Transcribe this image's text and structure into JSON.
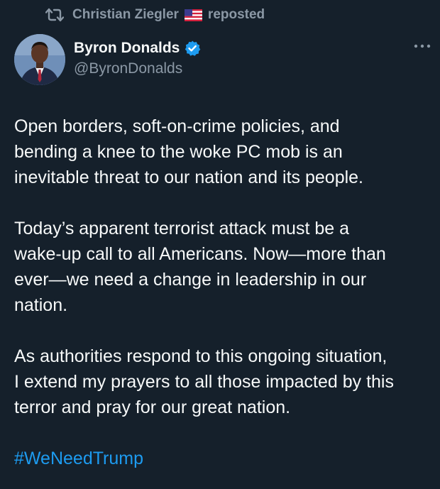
{
  "repost": {
    "icon": "repost-icon",
    "user": "Christian Ziegler",
    "flag": "us-flag-icon",
    "label": "reposted"
  },
  "author": {
    "avatar": "avatar",
    "display_name": "Byron Donalds",
    "verified_icon": "verified-badge-icon",
    "handle": "@ByronDonalds"
  },
  "more_icon": "more-options-icon",
  "tweet": {
    "paragraphs": [
      [
        "Open borders, soft-on-crime policies, and",
        "bending a knee to the woke PC mob is an",
        "inevitable threat to our nation and its people."
      ],
      [
        "Today’s apparent terrorist attack must be a",
        "wake-up call to all Americans. Now—more than",
        "ever—we need a change in leadership in our",
        "nation."
      ],
      [
        "As authorities respond to this ongoing situation,",
        "I extend my prayers to all those impacted by this",
        "terror and pray for our great nation."
      ]
    ],
    "hashtag": "#WeNeedTrump"
  },
  "colors": {
    "background": "#15202b",
    "text": "#f7f9f9",
    "muted": "#8b98a5",
    "link": "#1d9bf0"
  }
}
